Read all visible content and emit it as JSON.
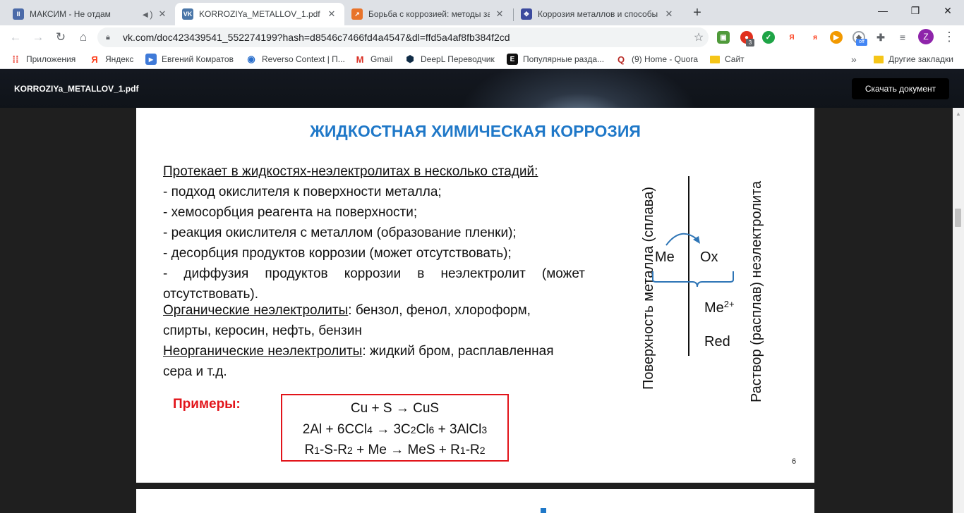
{
  "browser": {
    "tabs": [
      {
        "title": "МАКСИМ - Не отдам",
        "icon": "pause-icon",
        "color": "#4b6aa8",
        "active": false
      },
      {
        "title": "KORROZIYa_METALLOV_1.pdf",
        "icon": "vk-icon",
        "color": "#4a76a8",
        "active": true
      },
      {
        "title": "Борьба с коррозией: методы за",
        "icon": "zen-icon",
        "color": "#e8732a",
        "active": false
      },
      {
        "title": "Коррозия металлов и способы",
        "icon": "site-icon",
        "color": "#3c4a9e",
        "active": false
      }
    ],
    "url": "vk.com/doc423439541_552274199?hash=d8546c7466fd4a4547&dl=ffd5a4af8fb384f2cd",
    "profile_initial": "Z",
    "extension_badge": "3",
    "extension_off": "off"
  },
  "bookmarks": [
    {
      "label": "Приложения",
      "icon": "apps-grid-icon",
      "color": "#e94235"
    },
    {
      "label": "Яндекс",
      "icon": "yandex-icon",
      "color": "#fc3f1d"
    },
    {
      "label": "Евгений Комратов",
      "icon": "video-icon",
      "color": "#3f7ad8"
    },
    {
      "label": "Reverso Context | П...",
      "icon": "reverso-icon",
      "color": "#2a6fcc"
    },
    {
      "label": "Gmail",
      "icon": "gmail-icon",
      "color": "#d93025"
    },
    {
      "label": "DeepL Переводчик",
      "icon": "deepl-icon",
      "color": "#0f2b46"
    },
    {
      "label": "Популярные разда...",
      "icon": "page-icon",
      "color": "#111111"
    },
    {
      "label": "(9) Home - Quora",
      "icon": "quora-icon",
      "color": "#b92b27"
    },
    {
      "label": "Сайт",
      "icon": "folder-icon",
      "color": "#f5c518"
    },
    {
      "label": "Другие закладки",
      "icon": "folder-icon",
      "color": "#f5c518"
    }
  ],
  "document": {
    "filename": "KORROZIYa_METALLOV_1.pdf",
    "download_label": "Скачать документ"
  },
  "slide": {
    "title": "ЖИДКОСТНАЯ ХИМИЧЕСКАЯ КОРРОЗИЯ",
    "intro": "Протекает в жидкостях-неэлектролитах в несколько стадий:",
    "stages": [
      "- подход окислителя к поверхности металла;",
      "- хемосорбция реагента на поверхности;",
      "- реакция окислителя с металлом (образование пленки);",
      "- десорбция продуктов коррозии (может отсутствовать);",
      "- диффузия продуктов коррозии в неэлектролит (может",
      "отсутствовать)."
    ],
    "organic_label": "Органические неэлектролиты",
    "organic_text": ": бензол, фенол, хлороформ,",
    "organic_text2": "спирты, керосин, нефть, бензин",
    "inorganic_label": "Неорганические неэлектролиты",
    "inorganic_text": ": жидкий бром, расплавленная",
    "inorganic_text2": "сера и т.д.",
    "examples_label": "Примеры:",
    "formula1": "Cu + S → CuS",
    "formula2": {
      "a": "2Al + 6CCl",
      "b": "4",
      "c": " → 3C",
      "d": "2",
      "e": "Cl",
      "f": "6",
      "g": " + 3AlCl",
      "h": "3"
    },
    "formula3": {
      "a": "R",
      "b": "1",
      "c": "-S-R",
      "d": "2",
      "e": " + Me → MeS + R",
      "f": "1",
      "g": "-R",
      "h": "2"
    },
    "page_number": "6",
    "diagram": {
      "left_label": "Поверхность металла (сплава)",
      "right_label": "Раствор (расплав) неэлектролита",
      "me": "Me",
      "ox": "Ox",
      "me_ion": "Me",
      "me_ion_charge": "2+",
      "red": "Red",
      "accent": "#2e75b6"
    }
  }
}
